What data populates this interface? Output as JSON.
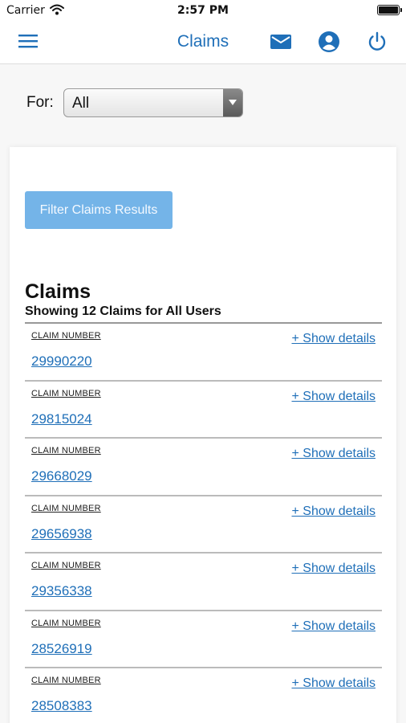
{
  "status_bar": {
    "carrier": "Carrier",
    "time": "2:57 PM"
  },
  "nav": {
    "title": "Claims",
    "accent_color": "#1f6fb8",
    "icons": [
      "menu-icon",
      "mail-icon",
      "account-icon",
      "power-icon"
    ]
  },
  "filter": {
    "for_label": "For:",
    "selected": "All",
    "button_label": "Filter Claims Results",
    "button_color": "#74b4e8"
  },
  "claims": {
    "heading": "Claims",
    "subheading": "Showing 12 Claims for All Users",
    "column_label": "CLAIM NUMBER",
    "details_label": "+ Show details",
    "rows": [
      {
        "number": "29990220"
      },
      {
        "number": "29815024"
      },
      {
        "number": "29668029"
      },
      {
        "number": "29656938"
      },
      {
        "number": "29356338"
      },
      {
        "number": "28526919"
      },
      {
        "number": "28508383"
      }
    ]
  }
}
